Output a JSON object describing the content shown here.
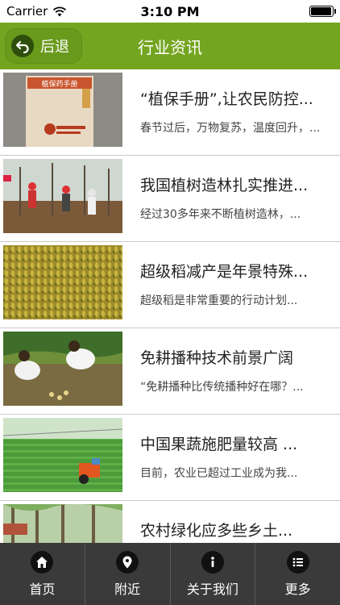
{
  "status_bar": {
    "carrier": "Carrier",
    "time": "3:10 PM",
    "battery_level": 0.95
  },
  "nav": {
    "back_label": "后退",
    "title": "行业资讯"
  },
  "articles": [
    {
      "title": "“植保手册”,让农民防控...",
      "desc": "春节过后，万物复苏，温度回升，...",
      "thumb_label": "植保药手册"
    },
    {
      "title": "我国植树造林扎实推进...",
      "desc": "经过30多年来不断植树造林，...",
      "thumb_label": ""
    },
    {
      "title": "超级稻减产是年景特殊...",
      "desc": "超级稻是非常重要的行动计划...",
      "thumb_label": ""
    },
    {
      "title": "免耕播种技术前景广阔",
      "desc": "“免耕播种比传统播种好在哪？...",
      "thumb_label": ""
    },
    {
      "title": "中国果蔬施肥量较高 ...",
      "desc": "目前，农业已超过工业成为我...",
      "thumb_label": ""
    },
    {
      "title": "农村绿化应多些乡土...",
      "desc": "",
      "thumb_label": ""
    }
  ],
  "tabs": [
    {
      "label": "首页",
      "icon": "home-icon"
    },
    {
      "label": "附近",
      "icon": "location-pin-icon"
    },
    {
      "label": "关于我们",
      "icon": "info-icon"
    },
    {
      "label": "更多",
      "icon": "list-icon"
    }
  ],
  "colors": {
    "nav_green": "#74a520",
    "tab_bar": "#3a3a3a"
  }
}
